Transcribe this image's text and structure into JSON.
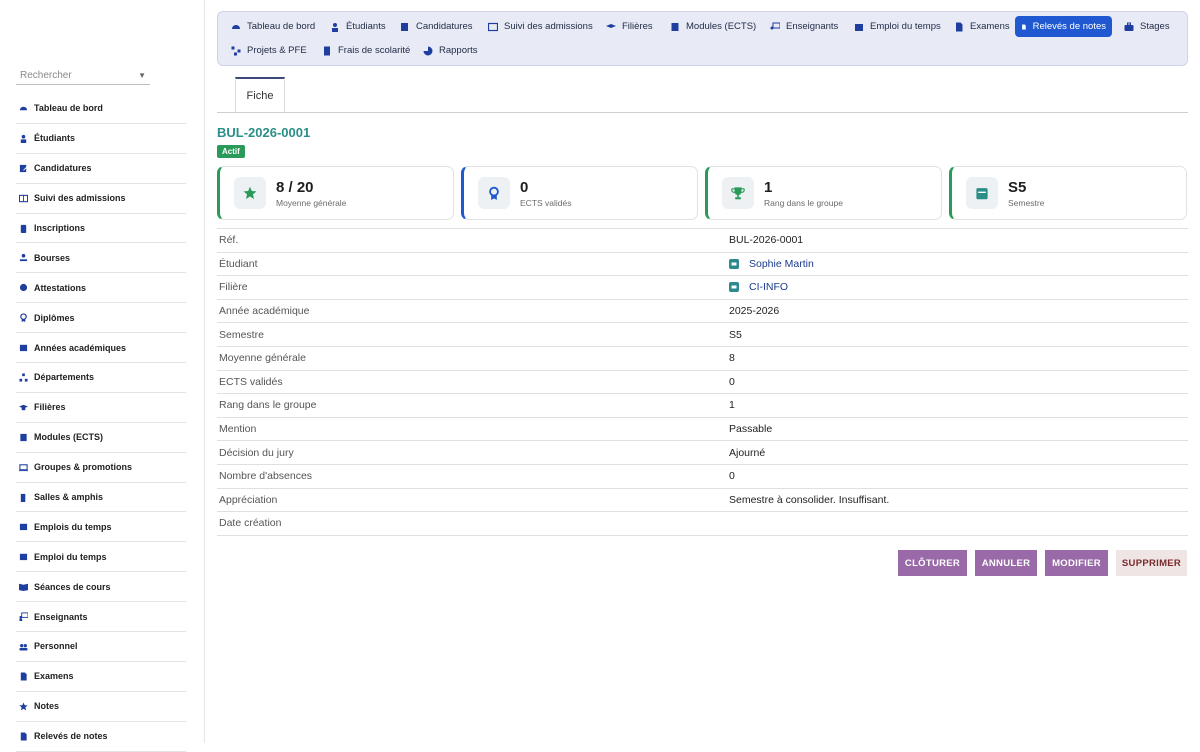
{
  "sidebar": {
    "search_placeholder": "Rechercher",
    "items": [
      {
        "label": "Tableau de bord",
        "icon": "gauge-icon"
      },
      {
        "label": "Étudiants",
        "icon": "student-icon"
      },
      {
        "label": "Candidatures",
        "icon": "form-icon"
      },
      {
        "label": "Suivi des admissions",
        "icon": "table-icon"
      },
      {
        "label": "Inscriptions",
        "icon": "clipboard-icon"
      },
      {
        "label": "Bourses",
        "icon": "hand-coin-icon"
      },
      {
        "label": "Attestations",
        "icon": "seal-icon"
      },
      {
        "label": "Diplômes",
        "icon": "award-icon"
      },
      {
        "label": "Années académiques",
        "icon": "calendar-icon"
      },
      {
        "label": "Départements",
        "icon": "sitemap-icon"
      },
      {
        "label": "Filières",
        "icon": "graduation-cap-icon"
      },
      {
        "label": "Modules (ECTS)",
        "icon": "book-icon"
      },
      {
        "label": "Groupes & promotions",
        "icon": "screen-icon"
      },
      {
        "label": "Salles & amphis",
        "icon": "door-icon"
      },
      {
        "label": "Emplois du temps",
        "icon": "calendar-icon"
      },
      {
        "label": "Emploi du temps",
        "icon": "calendar-icon"
      },
      {
        "label": "Séances de cours",
        "icon": "open-book-icon"
      },
      {
        "label": "Enseignants",
        "icon": "teacher-icon"
      },
      {
        "label": "Personnel",
        "icon": "users-icon"
      },
      {
        "label": "Examens",
        "icon": "file-icon"
      },
      {
        "label": "Notes",
        "icon": "star-icon"
      },
      {
        "label": "Relevés de notes",
        "icon": "document-icon"
      }
    ]
  },
  "topnav": {
    "items": [
      {
        "label": "Tableau de bord",
        "icon": "gauge-icon",
        "active": false
      },
      {
        "label": "Étudiants",
        "icon": "student-icon",
        "active": false
      },
      {
        "label": "Candidatures",
        "icon": "form-icon",
        "active": false
      },
      {
        "label": "Suivi des admissions",
        "icon": "table-icon",
        "active": false
      },
      {
        "label": "Filières",
        "icon": "graduation-cap-icon",
        "active": false
      },
      {
        "label": "Modules (ECTS)",
        "icon": "book-icon",
        "active": false
      },
      {
        "label": "Enseignants",
        "icon": "teacher-icon",
        "active": false
      },
      {
        "label": "Emploi du temps",
        "icon": "calendar-icon",
        "active": false
      },
      {
        "label": "Examens",
        "icon": "file-icon",
        "active": false
      },
      {
        "label": "Relevés de notes",
        "icon": "document-icon",
        "active": true
      },
      {
        "label": "Stages",
        "icon": "briefcase-icon",
        "active": false
      },
      {
        "label": "Projets & PFE",
        "icon": "project-diagram-icon",
        "active": false
      },
      {
        "label": "Frais de scolarité",
        "icon": "receipt-icon",
        "active": false
      },
      {
        "label": "Rapports",
        "icon": "pie-chart-icon",
        "active": false
      }
    ]
  },
  "tabs": [
    {
      "label": "Fiche",
      "active": true
    }
  ],
  "record": {
    "ref": "BUL-2026-0001",
    "status": "Actif",
    "status_color": "#2a9a5a",
    "accent_color": "#2a8f87"
  },
  "cards": [
    {
      "value": "8 / 20",
      "label": "Moyenne générale",
      "icon": "star-icon",
      "border_color": "#2a9a5a",
      "icon_color": "#2a9a5a"
    },
    {
      "value": "0",
      "label": "ECTS validés",
      "icon": "award-icon",
      "border_color": "#1f58d0",
      "icon_color": "#1f58d0"
    },
    {
      "value": "1",
      "label": "Rang dans le groupe",
      "icon": "trophy-icon",
      "border_color": "#2a9a5a",
      "icon_color": "#2a9a5a"
    },
    {
      "value": "S5",
      "label": "Semestre",
      "icon": "calendar-icon",
      "border_color": "#2a9a5a",
      "icon_color": "#2a8f87"
    }
  ],
  "details": [
    {
      "key": "Réf.",
      "value": "BUL-2026-0001",
      "link": false
    },
    {
      "key": "Étudiant",
      "value": "Sophie Martin",
      "link": true
    },
    {
      "key": "Filière",
      "value": "CI-INFO",
      "link": true
    },
    {
      "key": "Année académique",
      "value": "2025-2026",
      "link": false
    },
    {
      "key": "Semestre",
      "value": "S5",
      "link": false
    },
    {
      "key": "Moyenne générale",
      "value": "8",
      "link": false
    },
    {
      "key": "ECTS validés",
      "value": "0",
      "link": false
    },
    {
      "key": "Rang dans le groupe",
      "value": "1",
      "link": false
    },
    {
      "key": "Mention",
      "value": "Passable",
      "link": false
    },
    {
      "key": "Décision du jury",
      "value": "Ajourné",
      "link": false
    },
    {
      "key": "Nombre d'absences",
      "value": "0",
      "link": false
    },
    {
      "key": "Appréciation",
      "value": "Semestre à consolider. Insuffisant.",
      "link": false
    },
    {
      "key": "Date création",
      "value": "",
      "link": false
    }
  ],
  "actions": {
    "cloturer": "CLÔTURER",
    "annuler": "ANNULER",
    "modifier": "MODIFIER",
    "supprimer": "SUPPRIMER",
    "primary_color": "#9a6aa8",
    "danger_bg": "#efe5e5",
    "danger_text": "#7a2a2a"
  }
}
